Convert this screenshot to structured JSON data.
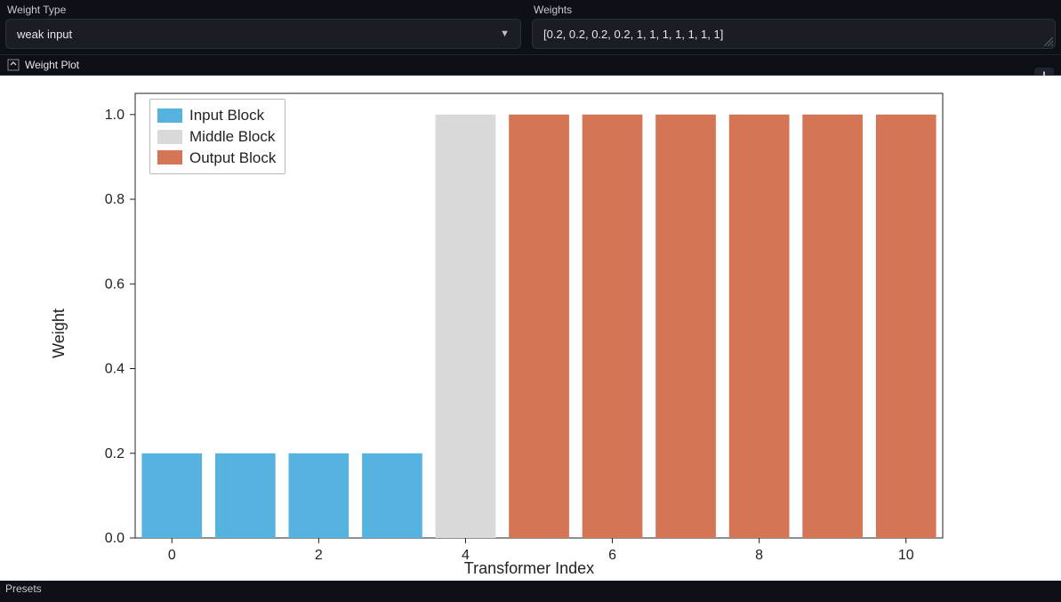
{
  "header": {
    "weight_type_label": "Weight Type",
    "weight_type_value": "weak input",
    "weights_label": "Weights",
    "weights_value": "[0.2, 0.2, 0.2, 0.2, 1, 1, 1, 1, 1, 1, 1]"
  },
  "panel": {
    "title": "Weight Plot"
  },
  "legend": {
    "input": "Input Block",
    "middle": "Middle Block",
    "output": "Output Block"
  },
  "axis": {
    "xlabel": "Transformer Index",
    "ylabel": "Weight",
    "xticks": {
      "t0": "0",
      "t2": "2",
      "t4": "4",
      "t6": "6",
      "t8": "8",
      "t10": "10"
    },
    "yticks": {
      "y0": "0.0",
      "y2": "0.2",
      "y4": "0.4",
      "y6": "0.6",
      "y8": "0.8",
      "y10": "1.0"
    }
  },
  "footer": {
    "presets": "Presets"
  },
  "colors": {
    "input": "#56b3e0",
    "middle": "#d9d9d9",
    "output": "#d47555",
    "axis": "#222222"
  },
  "chart_data": {
    "type": "bar",
    "title": "",
    "xlabel": "Transformer Index",
    "ylabel": "Weight",
    "ylim": [
      0,
      1.05
    ],
    "xticks": [
      0,
      2,
      4,
      6,
      8,
      10
    ],
    "yticks": [
      0.0,
      0.2,
      0.4,
      0.6,
      0.8,
      1.0
    ],
    "categories": [
      0,
      1,
      2,
      3,
      4,
      5,
      6,
      7,
      8,
      9,
      10
    ],
    "series": [
      {
        "name": "Input Block",
        "color": "#56b3e0",
        "indices": [
          0,
          1,
          2,
          3
        ],
        "values": [
          0.2,
          0.2,
          0.2,
          0.2
        ]
      },
      {
        "name": "Middle Block",
        "color": "#d9d9d9",
        "indices": [
          4
        ],
        "values": [
          1.0
        ]
      },
      {
        "name": "Output Block",
        "color": "#d47555",
        "indices": [
          5,
          6,
          7,
          8,
          9,
          10
        ],
        "values": [
          1.0,
          1.0,
          1.0,
          1.0,
          1.0,
          1.0
        ]
      }
    ],
    "values": [
      0.2,
      0.2,
      0.2,
      0.2,
      1.0,
      1.0,
      1.0,
      1.0,
      1.0,
      1.0,
      1.0
    ],
    "block": [
      "input",
      "input",
      "input",
      "input",
      "middle",
      "output",
      "output",
      "output",
      "output",
      "output",
      "output"
    ]
  }
}
